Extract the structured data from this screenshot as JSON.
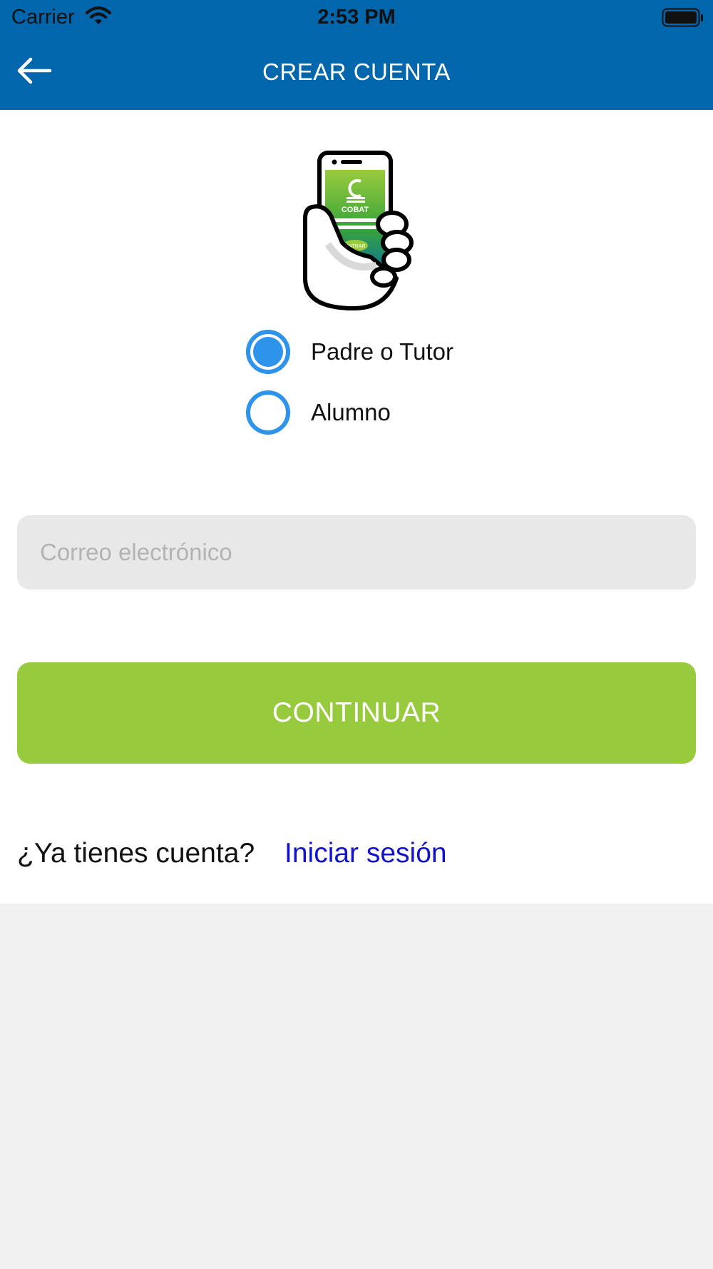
{
  "status_bar": {
    "carrier": "Carrier",
    "time": "2:53 PM",
    "icons": [
      "wifi-icon",
      "battery-icon"
    ]
  },
  "header": {
    "title": "CREAR CUENTA",
    "back_icon": "arrow-left-icon",
    "background_color": "#0166ab"
  },
  "illustration": {
    "icon": "hand-holding-phone-icon",
    "brand_text": "COBAT",
    "button_text": "ENTRAR"
  },
  "account_type": {
    "options": [
      {
        "label": "Padre o Tutor",
        "selected": true
      },
      {
        "label": "Alumno",
        "selected": false
      }
    ],
    "accent_color": "#2e93ea"
  },
  "email": {
    "placeholder": "Correo electrónico",
    "value": ""
  },
  "continue_button": {
    "label": "CONTINUAR",
    "color": "#98ca3e"
  },
  "login_prompt": {
    "text": "¿Ya tienes cuenta?",
    "link_label": "Iniciar sesión",
    "link_color": "#1212cc"
  }
}
